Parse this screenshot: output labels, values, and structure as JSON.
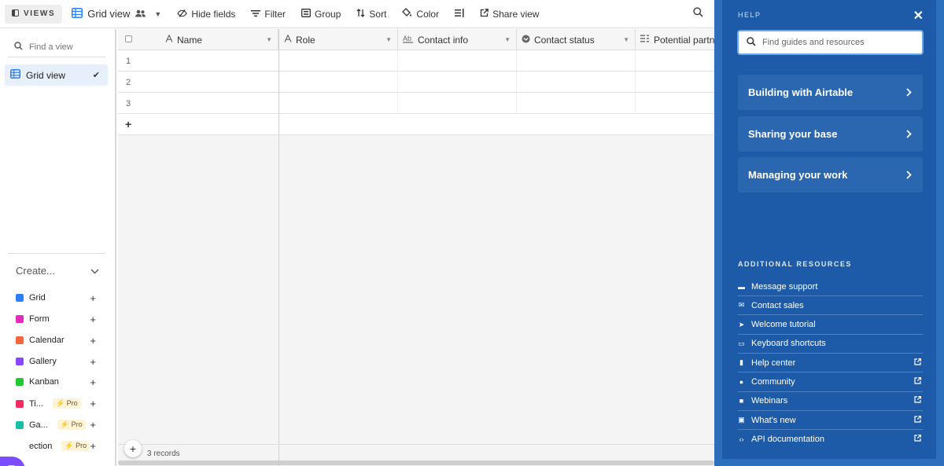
{
  "toolbar": {
    "views_label": "VIEWS",
    "view_name": "Grid view",
    "hide_fields": "Hide fields",
    "filter": "Filter",
    "group": "Group",
    "sort": "Sort",
    "color": "Color",
    "share_view": "Share view"
  },
  "sidebar": {
    "find_placeholder": "Find a view",
    "active_view": "Grid view",
    "create_label": "Create...",
    "create_items": [
      {
        "label": "Grid",
        "color": "#2d7ff9",
        "pro": ""
      },
      {
        "label": "Form",
        "color": "#e929ba",
        "pro": ""
      },
      {
        "label": "Calendar",
        "color": "#f7653b",
        "pro": ""
      },
      {
        "label": "Gallery",
        "color": "#8b46ff",
        "pro": ""
      },
      {
        "label": "Kanban",
        "color": "#20c933",
        "pro": ""
      },
      {
        "label": "Ti...",
        "color": "#f82b60",
        "pro": "Pro"
      },
      {
        "label": "Ga...",
        "color": "#18bfa6",
        "pro": "Pro"
      },
      {
        "label": "ection",
        "color": "#ffffff",
        "pro": "Pro"
      }
    ]
  },
  "grid": {
    "columns": [
      {
        "label": "Name",
        "icon": "text-icon"
      },
      {
        "label": "Role",
        "icon": "text-icon"
      },
      {
        "label": "Contact info",
        "icon": "long-text-icon"
      },
      {
        "label": "Contact status",
        "icon": "single-select-icon"
      },
      {
        "label": "Potential partne",
        "icon": "multi-select-icon"
      }
    ],
    "rows": [
      "1",
      "2",
      "3"
    ],
    "add_row": "+",
    "records_count": "3 records"
  },
  "help": {
    "label": "HELP",
    "search_placeholder": "Find guides and resources",
    "cards": [
      "Building with Airtable",
      "Sharing your base",
      "Managing your work"
    ],
    "resources_title": "ADDITIONAL RESOURCES",
    "resources": [
      {
        "label": "Message support",
        "icon": "chat-icon",
        "external": false
      },
      {
        "label": "Contact sales",
        "icon": "mail-icon",
        "external": false
      },
      {
        "label": "Welcome tutorial",
        "icon": "cursor-icon",
        "external": false
      },
      {
        "label": "Keyboard shortcuts",
        "icon": "keyboard-icon",
        "external": false
      },
      {
        "label": "Help center",
        "icon": "book-icon",
        "external": true
      },
      {
        "label": "Community",
        "icon": "globe-icon",
        "external": true
      },
      {
        "label": "Webinars",
        "icon": "video-icon",
        "external": true
      },
      {
        "label": "What's new",
        "icon": "gift-icon",
        "external": true
      },
      {
        "label": "API documentation",
        "icon": "code-icon",
        "external": true
      }
    ]
  }
}
